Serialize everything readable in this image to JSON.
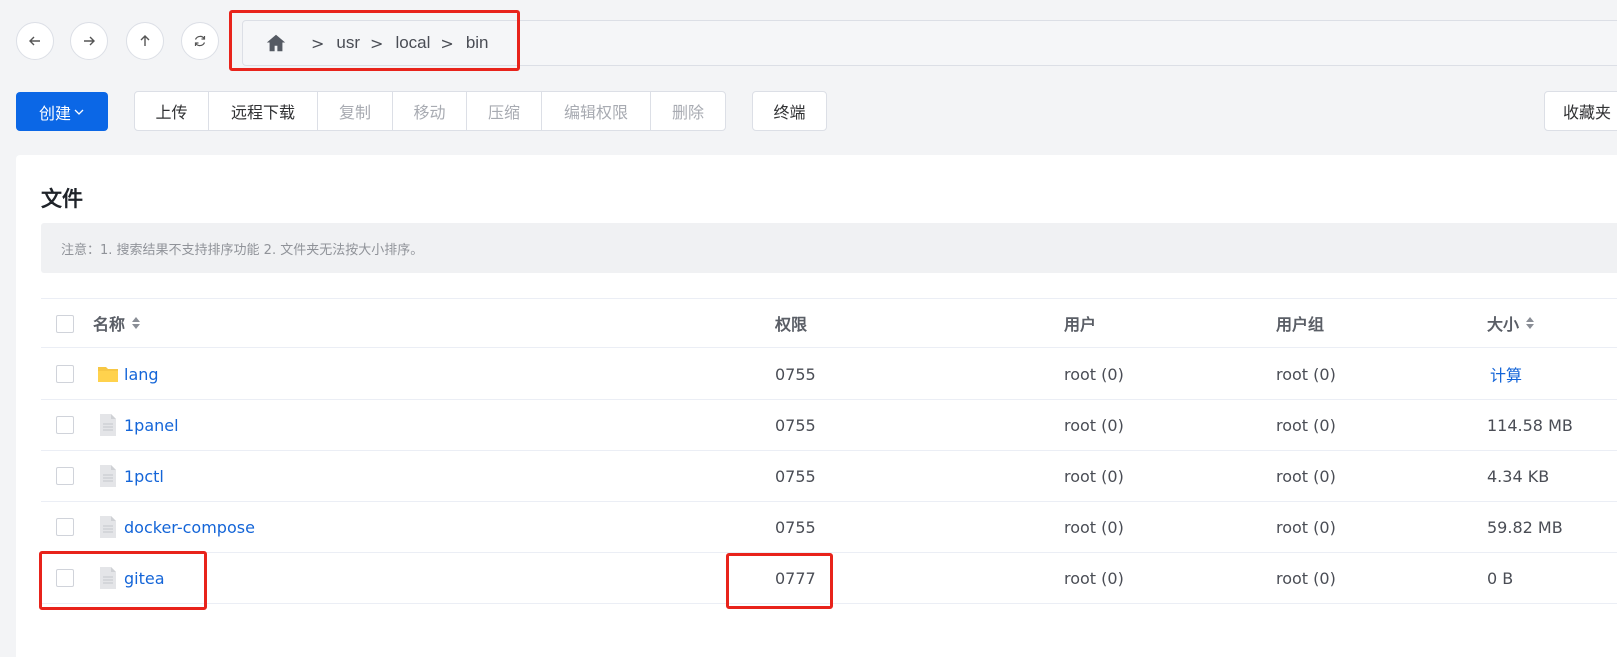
{
  "nav": {
    "back_icon": "arrow-left-icon",
    "forward_icon": "arrow-right-icon",
    "up_icon": "arrow-up-icon",
    "refresh_icon": "refresh-icon"
  },
  "path": {
    "home_icon": "home-icon",
    "separator": ">",
    "segments": [
      "usr",
      "local",
      "bin"
    ]
  },
  "toolbar": {
    "create_label": "创建",
    "upload_label": "上传",
    "remote_download_label": "远程下载",
    "copy_label": "复制",
    "move_label": "移动",
    "compress_label": "压缩",
    "edit_perm_label": "编辑权限",
    "delete_label": "删除",
    "terminal_label": "终端",
    "favorites_label": "收藏夹"
  },
  "panel": {
    "title": "文件",
    "notice": "注意：1. 搜索结果不支持排序功能 2. 文件夹无法按大小排序。"
  },
  "table": {
    "columns": {
      "name": "名称",
      "permission": "权限",
      "user": "用户",
      "group": "用户组",
      "size": "大小"
    },
    "rows": [
      {
        "name": "lang",
        "type": "folder",
        "permission": "0755",
        "user": "root (0)",
        "group": "root (0)",
        "size": "计算"
      },
      {
        "name": "1panel",
        "type": "file",
        "permission": "0755",
        "user": "root (0)",
        "group": "root (0)",
        "size": "114.58 MB"
      },
      {
        "name": "1pctl",
        "type": "file",
        "permission": "0755",
        "user": "root (0)",
        "group": "root (0)",
        "size": "4.34 KB"
      },
      {
        "name": "docker-compose",
        "type": "file",
        "permission": "0755",
        "user": "root (0)",
        "group": "root (0)",
        "size": "59.82 MB"
      },
      {
        "name": "gitea",
        "type": "file",
        "permission": "0777",
        "user": "root (0)",
        "group": "root (0)",
        "size": "0 B"
      }
    ]
  },
  "colors": {
    "primary": "#0b67e6",
    "link": "#1465d8",
    "highlight": "#e8231b",
    "folder": "#f7c744"
  }
}
